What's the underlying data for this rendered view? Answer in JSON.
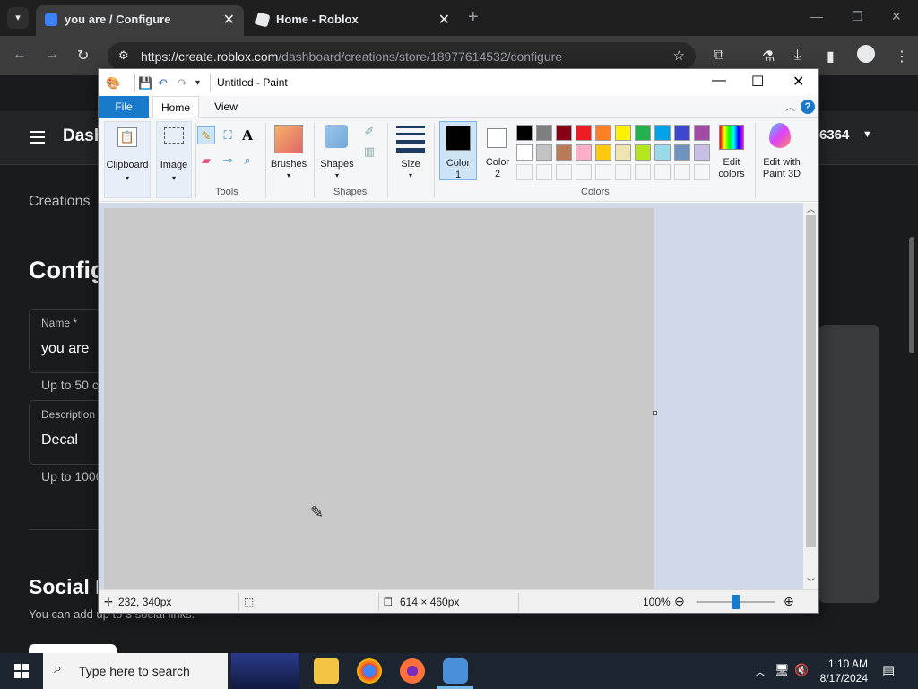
{
  "browser": {
    "tabs": [
      {
        "title": "you are / Configure",
        "active": true
      },
      {
        "title": "Home - Roblox",
        "active": false
      }
    ],
    "url_domain": "https://create.roblox.com",
    "url_path": "/dashboard/creations/store/18977614532/configure"
  },
  "roblox_page": {
    "header_title": "Dash",
    "header_user_suffix": "6364",
    "breadcrumb": "Creations",
    "page_title": "Config",
    "name_label": "Name *",
    "name_value": "you are",
    "name_hint": "Up to 50 c",
    "description_label": "Description",
    "description_value": "Decal",
    "description_hint": "Up to 1000",
    "social_heading": "Social L",
    "social_hint": "You can add up to 3 social links."
  },
  "paint": {
    "window_title": "Untitled - Paint",
    "tabs": [
      "File",
      "Home",
      "View"
    ],
    "groups": {
      "clipboard": "Clipboard",
      "image": "Image",
      "tools": "Tools",
      "brushes": "Brushes",
      "shapes": "Shapes",
      "size": "Size",
      "color1": "Color\n1",
      "color2": "Color\n2",
      "colors": "Colors",
      "edit_colors": "Edit\ncolors",
      "edit_paint3d": "Edit with\nPaint 3D"
    },
    "palette_row1": [
      "#000000",
      "#7f7f7f",
      "#880015",
      "#ed1c24",
      "#ff7f27",
      "#fff200",
      "#22b14c",
      "#00a2e8",
      "#3f48cc",
      "#a349a4"
    ],
    "palette_row2": [
      "#ffffff",
      "#c3c3c3",
      "#b97a57",
      "#ffaec9",
      "#ffc90e",
      "#efe4b0",
      "#b5e61d",
      "#99d9ea",
      "#7092be",
      "#c8bfe7"
    ],
    "status": {
      "cursor_pos": "232, 340px",
      "canvas_size": "614 × 460px",
      "zoom": "100%"
    }
  },
  "taskbar": {
    "search_placeholder": "Type here to search",
    "time": "1:10 AM",
    "date": "8/17/2024"
  }
}
